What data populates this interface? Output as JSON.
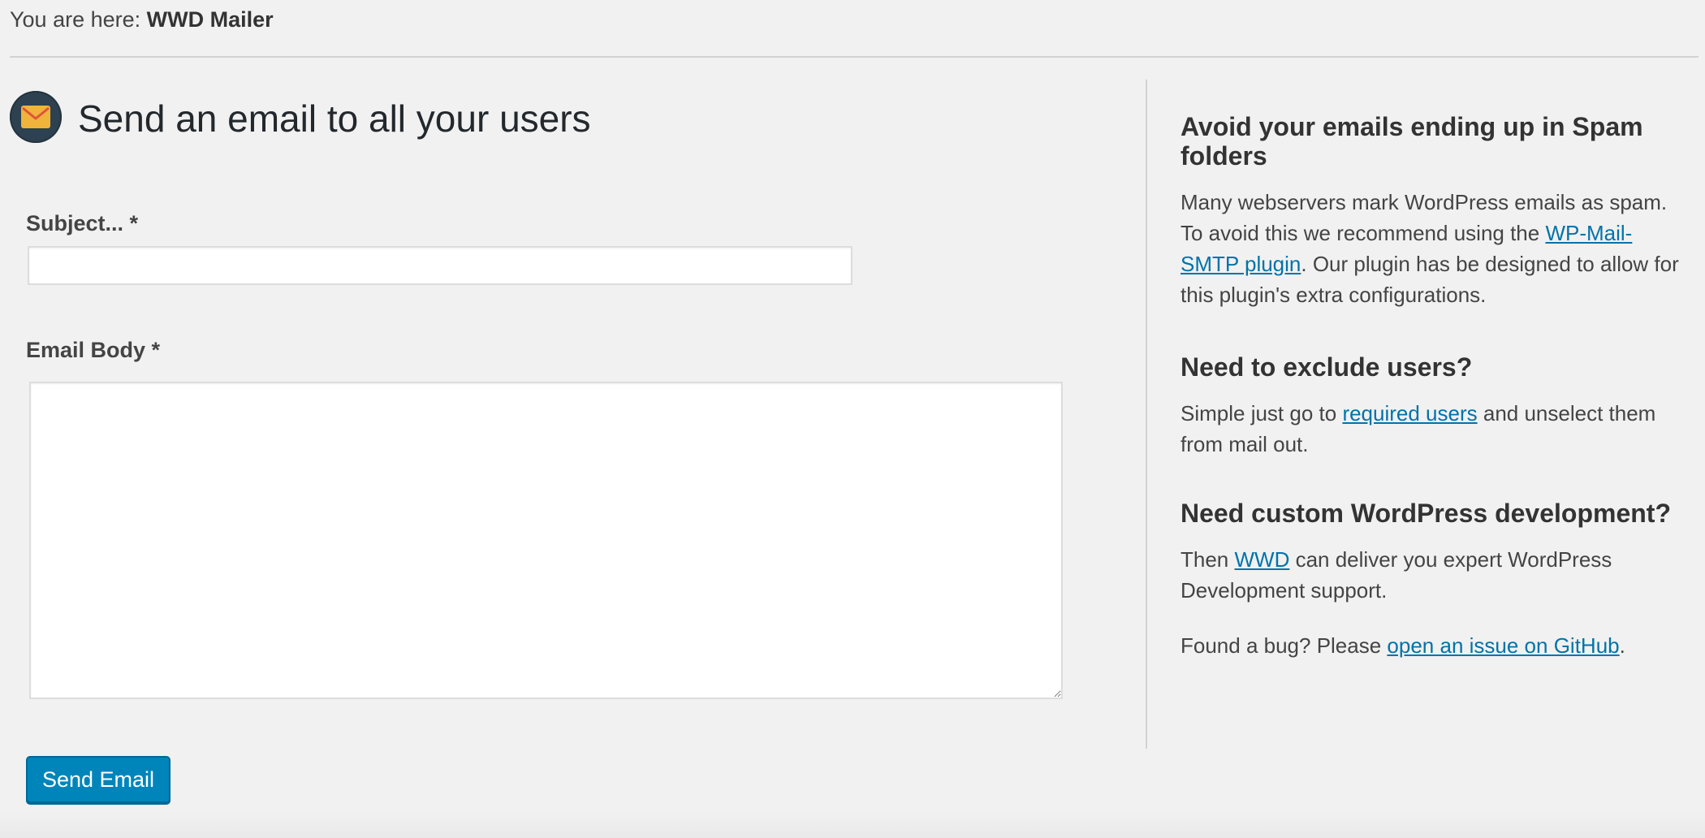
{
  "breadcrumb": {
    "prefix": "You are here: ",
    "current": "WWD Mailer"
  },
  "page": {
    "icon": "envelope-icon",
    "title": "Send an email to all your users"
  },
  "form": {
    "subject_label": "Subject... *",
    "subject_value": "",
    "body_label": "Email Body *",
    "body_value": "",
    "submit_label": "Send Email",
    "button_color": "#0085ba"
  },
  "sidebar": {
    "spam": {
      "heading": "Avoid your emails ending up in Spam folders",
      "text_before": "Many webservers mark WordPress emails as spam. To avoid this we recommend using the ",
      "link": "WP-Mail-SMTP plugin",
      "text_after": ". Our plugin has be designed to allow for this plugin's extra configurations."
    },
    "exclude": {
      "heading": "Need to exclude users?",
      "text_before": "Simple just go to ",
      "link": "required users",
      "text_after": " and unselect them from mail out."
    },
    "custom": {
      "heading": "Need custom WordPress development?",
      "text_before": "Then ",
      "link": "WWD",
      "text_after": " can deliver you expert WordPress Development support."
    },
    "bug": {
      "text_before": "Found a bug? Please ",
      "link": "open an issue on GitHub",
      "text_after": "."
    }
  },
  "colors": {
    "background": "#f1f1f1",
    "link": "#0073aa",
    "icon_circle": "#2d4150",
    "envelope": "#f0b43c"
  }
}
